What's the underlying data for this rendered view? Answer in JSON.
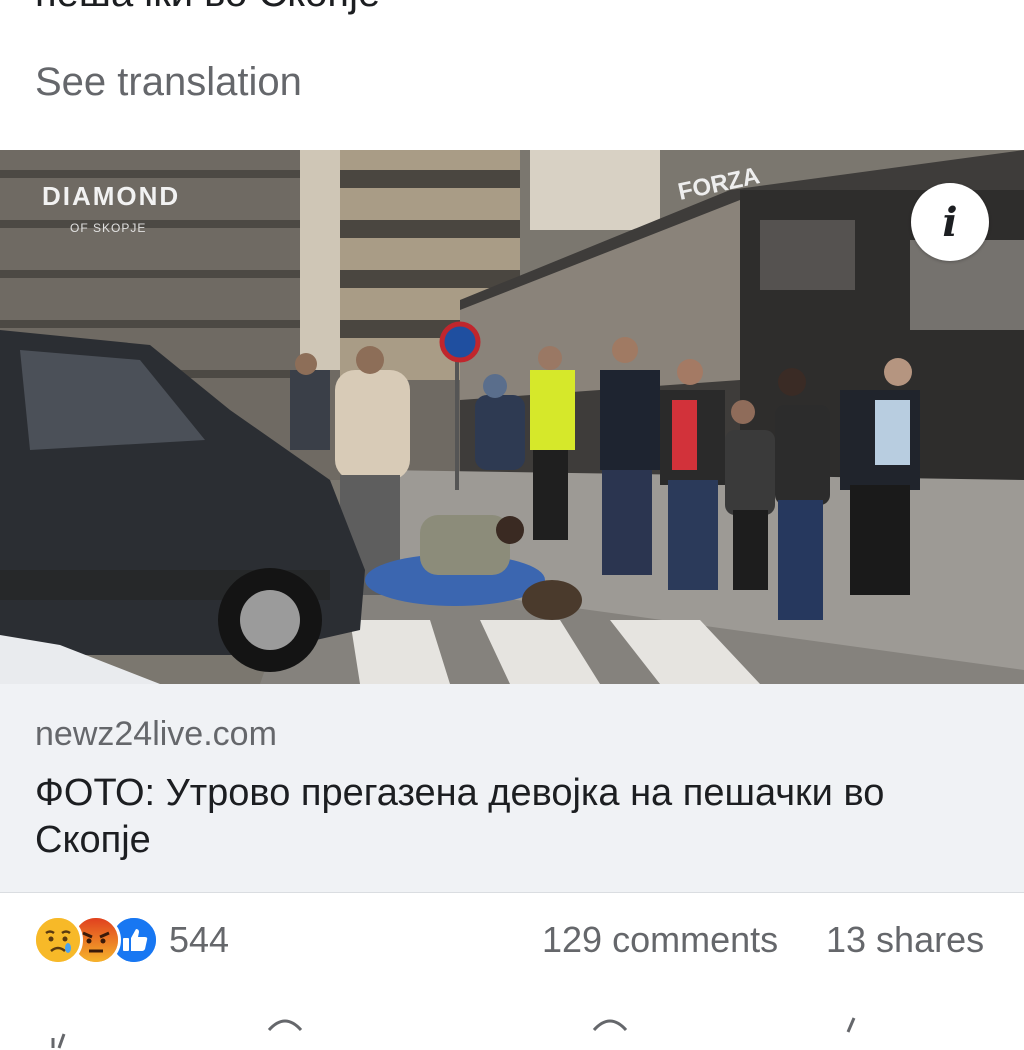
{
  "post": {
    "text_cut": "пешачки во Скопје",
    "see_translation": "See translation"
  },
  "link": {
    "domain": "newz24live.com",
    "title": "ФОТО: Утрово прегазена девојка на пешачки во Скопје",
    "image_signs": {
      "diamond": "DIAMOND",
      "diamond_sub": "OF SKOPJE",
      "forza": "FORZA"
    },
    "info_icon": "info-icon"
  },
  "engagement": {
    "reactions": [
      "sad-reaction-icon",
      "angry-reaction-icon",
      "like-reaction-icon"
    ],
    "reaction_count": "544",
    "comments": "129 comments",
    "shares": "13 shares"
  },
  "colors": {
    "secondary_text": "#65676b",
    "primary_text": "#1c1e21",
    "card_bg": "#f0f2f5",
    "like_blue": "#1877f2"
  }
}
